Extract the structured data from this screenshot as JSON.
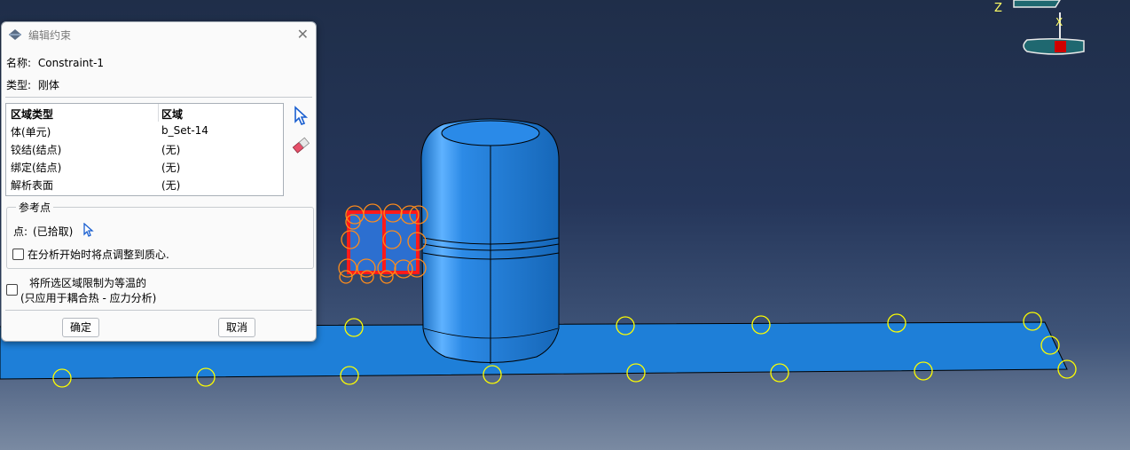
{
  "viewport": {
    "axis_labels": {
      "z": "Z",
      "x": "X"
    },
    "colors": {
      "part": "#1e7fd8",
      "seed": "#ffff00",
      "constraint": "#ff1a1a",
      "rp_circle": "#ff8c1a",
      "bg_top": "#1f2e49"
    }
  },
  "dialog": {
    "title": "编辑约束",
    "icon": "constraint-icon",
    "name_label": "名称:",
    "name_value": "Constraint-1",
    "type_label": "类型:",
    "type_value": "刚体",
    "table": {
      "headers": [
        "区域类型",
        "区域"
      ],
      "rows": [
        [
          "体(单元)",
          "b_Set-14"
        ],
        [
          "铰结(结点)",
          "(无)"
        ],
        [
          "绑定(结点)",
          "(无)"
        ],
        [
          "解析表面",
          "(无)"
        ]
      ]
    },
    "tools": {
      "select": "select-arrow-icon",
      "erase": "eraser-icon"
    },
    "ref_point": {
      "legend": "参考点",
      "point_label": "点:",
      "point_value": "(已拾取)",
      "adjust_label": "在分析开始时将点调整到质心."
    },
    "isothermal_label": "将所选区域限制为等温的",
    "isothermal_note": "(只应用于耦合热 - 应力分析)",
    "ok_label": "确定",
    "cancel_label": "取消"
  }
}
